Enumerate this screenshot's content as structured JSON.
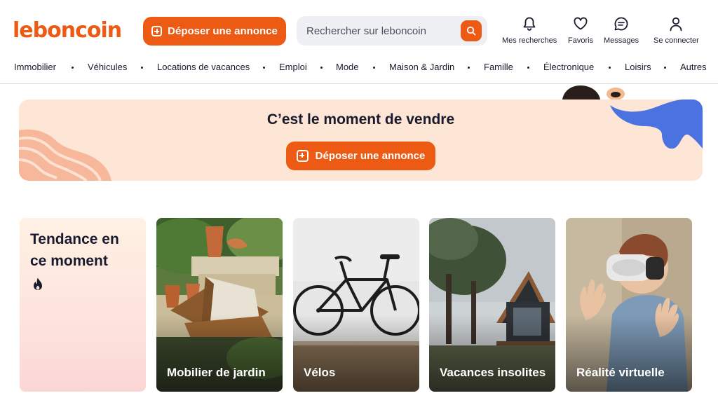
{
  "header": {
    "logo_text": "leboncoin",
    "post_ad_label": "Déposer une annonce",
    "search_placeholder": "Rechercher sur leboncoin",
    "actions": [
      {
        "label": "Mes recherches",
        "icon": "bell-icon"
      },
      {
        "label": "Favoris",
        "icon": "heart-icon"
      },
      {
        "label": "Messages",
        "icon": "chat-icon"
      },
      {
        "label": "Se connecter",
        "icon": "user-icon"
      }
    ]
  },
  "nav": {
    "items": [
      "Immobilier",
      "Véhicules",
      "Locations de vacances",
      "Emploi",
      "Mode",
      "Maison & Jardin",
      "Famille",
      "Électronique",
      "Loisirs",
      "Autres"
    ]
  },
  "hero": {
    "title": "C’est le moment de vendre",
    "button_label": "Déposer une annonce"
  },
  "trending": {
    "title": "Tendance en ce moment",
    "icon": "fire-icon",
    "cards": [
      {
        "label": "Mobilier de jardin"
      },
      {
        "label": "Vélos"
      },
      {
        "label": "Vacances insolites"
      },
      {
        "label": "Réalité virtuelle"
      }
    ]
  },
  "colors": {
    "brand_orange": "#ec5a13",
    "hero_bg": "#fee6d6",
    "search_bg": "#eef0f4",
    "accent_blue": "#4a72e0"
  }
}
